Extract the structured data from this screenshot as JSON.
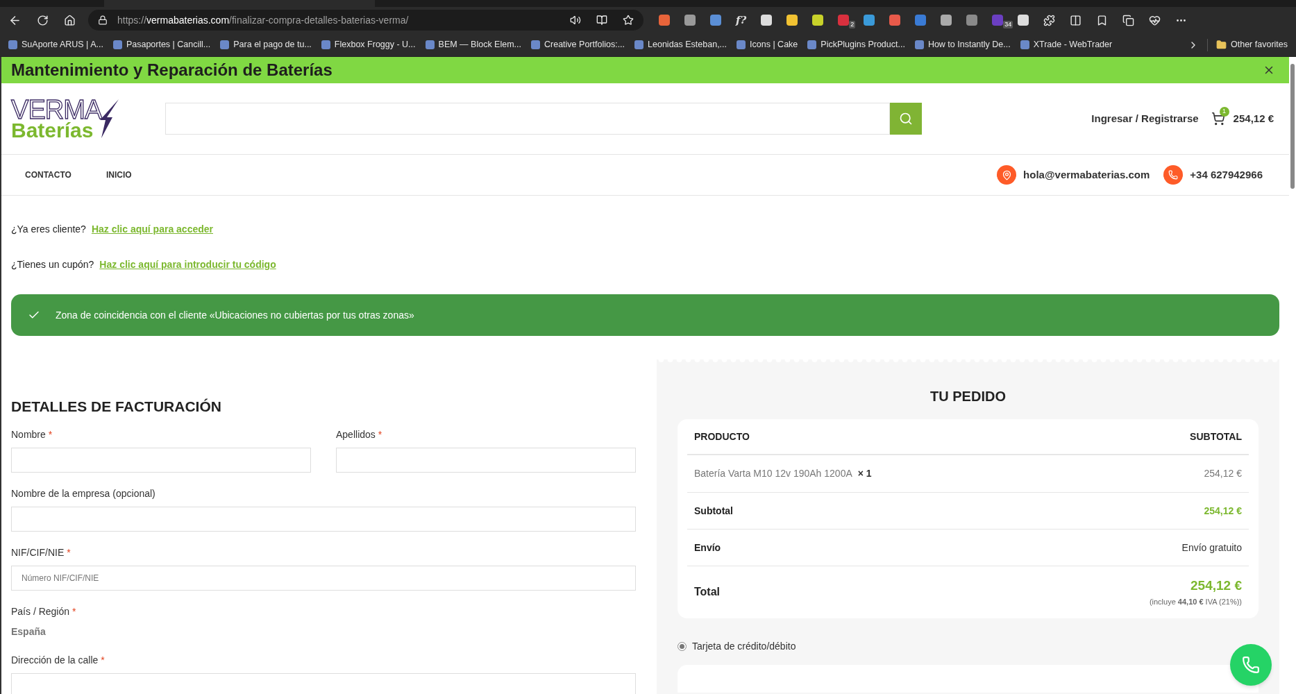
{
  "browser": {
    "url_prefix": "https://",
    "url_host": "vermabaterias.com",
    "url_path": "/finalizar-compra-detalles-baterias-verma/",
    "extension_label": "f?",
    "extension_badges": [
      "2",
      "34"
    ],
    "bookmarks": [
      "SuAporte ARUS | A...",
      "Pasaportes | Cancill...",
      "Para el pago de tu...",
      "Flexbox Froggy - U...",
      "BEM — Block Elem...",
      "Creative Portfolios:...",
      "Leonidas Esteban,...",
      "Icons | Cake",
      "PickPlugins Product...",
      "How to Instantly De...",
      "XTrade - WebTrader"
    ],
    "other_favorites": "Other favorites"
  },
  "banner": {
    "title": "Mantenimiento y Reparación de Baterías"
  },
  "header": {
    "logo_top": "VERMA",
    "logo_bottom": "Baterías",
    "account": "Ingresar / Registrarse",
    "cart_count": "1",
    "cart_total": "254,12 €"
  },
  "nav": {
    "items": [
      "CONTACTO",
      "INICIO"
    ],
    "email": "hola@vermabaterias.com",
    "phone": "+34 627942966"
  },
  "notices": [
    {
      "question": "¿Ya eres cliente?",
      "link": "Haz clic aquí para acceder"
    },
    {
      "question": "¿Tienes un cupón?",
      "link": "Haz clic aquí para introducir tu código"
    }
  ],
  "zone_message": "Zona de coincidencia con el cliente «Ubicaciones no cubiertas por tus otras zonas»",
  "billing": {
    "title": "DETALLES DE FACTURACIÓN",
    "required_mark": "*",
    "rows": [
      {
        "fields": [
          {
            "kind": "input",
            "label": "Nombre",
            "required": true
          },
          {
            "kind": "input",
            "label": "Apellidos",
            "required": true
          }
        ]
      },
      {
        "fields": [
          {
            "kind": "input",
            "label": "Nombre de la empresa (opcional)",
            "required": false
          }
        ]
      },
      {
        "fields": [
          {
            "kind": "input",
            "label": "NIF/CIF/NIE",
            "required": true,
            "placeholder": "Número NIF/CIF/NIE"
          }
        ]
      },
      {
        "fields": [
          {
            "kind": "static",
            "label": "País / Región",
            "required": true,
            "value": "España"
          }
        ]
      },
      {
        "fields": [
          {
            "kind": "input",
            "label": "Dirección de la calle",
            "required": true
          }
        ]
      }
    ]
  },
  "order": {
    "title": "TU PEDIDO",
    "columns": [
      "PRODUCTO",
      "SUBTOTAL"
    ],
    "items": [
      {
        "name": "Batería Varta M10 12v 190Ah 1200A",
        "quantity": "× 1",
        "subtotal": "254,12 €"
      }
    ],
    "subtotal": {
      "label": "Subtotal",
      "value": "254,12 €"
    },
    "shipping": {
      "label": "Envío",
      "value": "Envío gratuito"
    },
    "total": {
      "label": "Total",
      "value": "254,12 €",
      "tax_note": "(incluye **44,10 €** IVA (21%))"
    },
    "payment_methods": [
      {
        "label": "Tarjeta de crédito/débito",
        "selected": true
      }
    ]
  }
}
